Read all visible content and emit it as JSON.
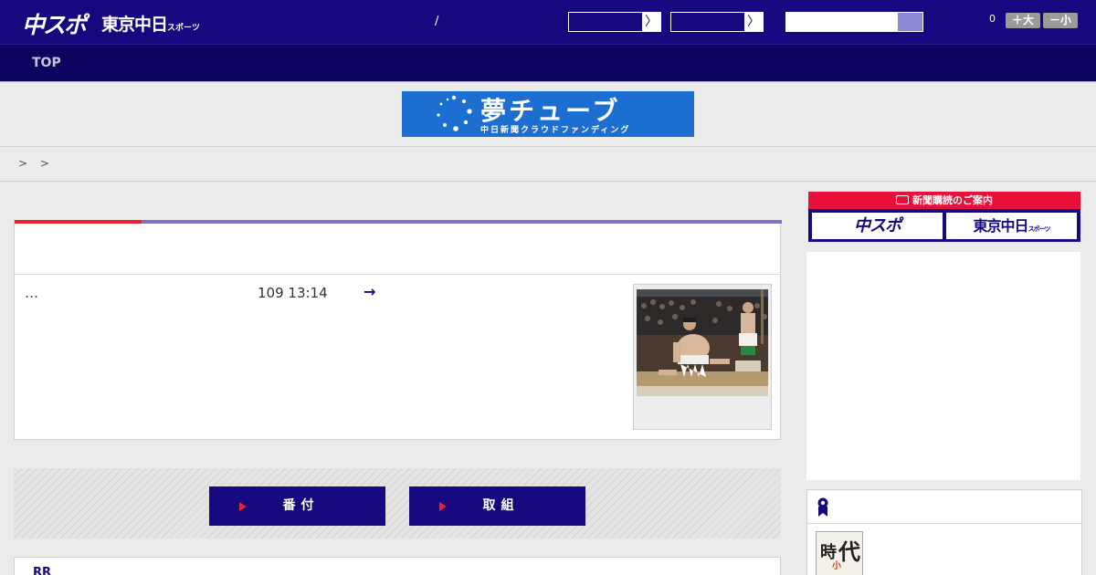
{
  "header": {
    "logo_chuspo": "中スポ",
    "logo_tokyo_main": "東京中日",
    "logo_tokyo_sub": "スポーツ",
    "slash": "/",
    "select1_arrow": "〉",
    "select2_arrow": "〉",
    "font_count": "0",
    "font_larger": "＋大",
    "font_smaller": "－小"
  },
  "nav": {
    "top_label": "TOP"
  },
  "banner": {
    "main": "夢チューブ",
    "sub": "中日新聞クラウドファンディング"
  },
  "breadcrumb": {
    "text": "> >"
  },
  "article": {
    "ellipsis": "…",
    "date": "109 13:14",
    "arrow": "→"
  },
  "link_band": {
    "banzuke": "番付",
    "torikumi": "取組"
  },
  "bottom_card": {
    "label": "RR"
  },
  "sidebar": {
    "subscription_title": "新聞購読のご案内",
    "chuspo_link": "中スポ",
    "tokyo_link_main": "東京中日",
    "tokyo_link_sub": "スポーツ",
    "thumb_k1": "時",
    "thumb_k2": "代",
    "thumb_k3": "小"
  },
  "colors": {
    "header_bg": "#16087e",
    "nav_bg": "#0d0460",
    "accent_red": "#e8222e",
    "accent_purple": "#7a74c6",
    "banner_blue": "#1c6fd1"
  }
}
